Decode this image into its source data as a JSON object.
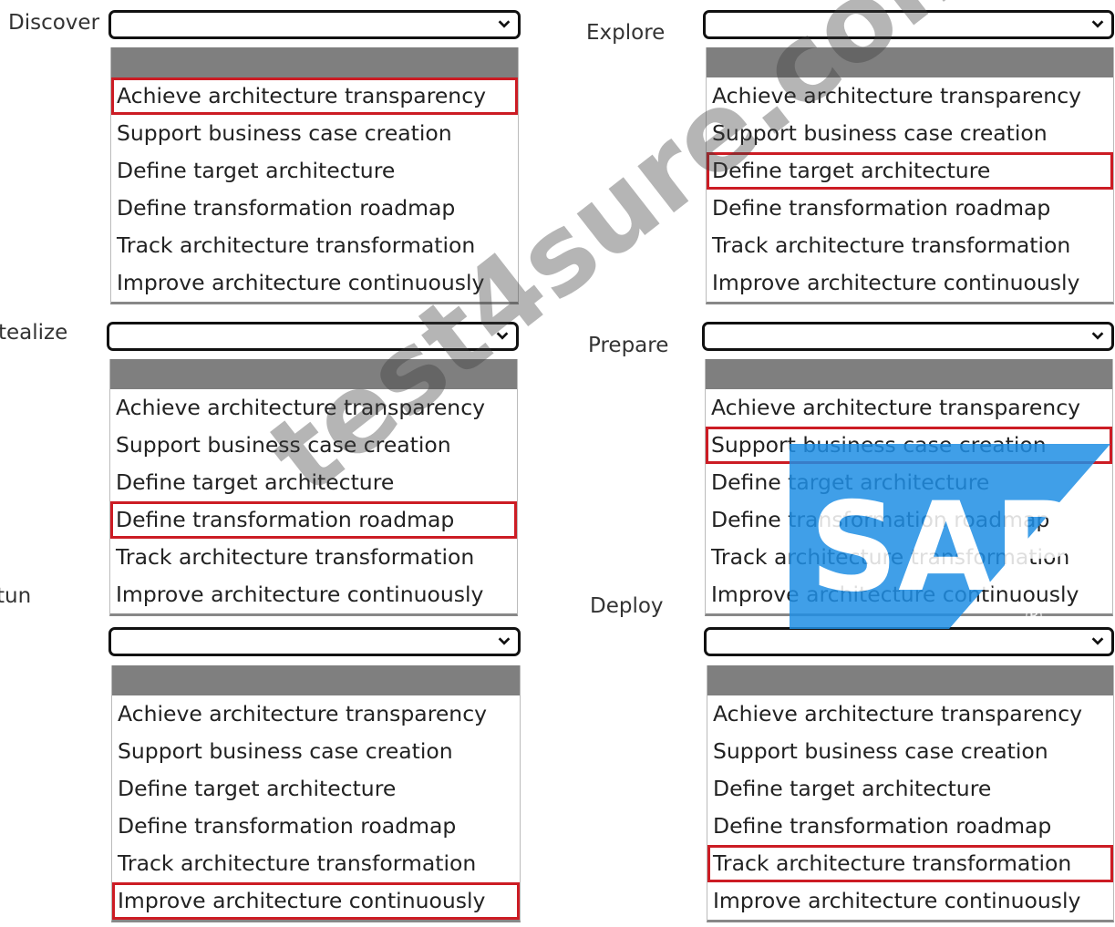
{
  "options": [
    "Achieve architecture transparency",
    "Support business case creation",
    "Define target architecture",
    "Define transformation roadmap",
    "Track architecture transformation",
    "Improve architecture continuously"
  ],
  "phases": [
    {
      "label": "Discover",
      "selected_index": 0
    },
    {
      "label": "Explore",
      "selected_index": 2
    },
    {
      "label": "tealize",
      "selected_index": 3
    },
    {
      "label": "Prepare",
      "selected_index": 1
    },
    {
      "label": "tun",
      "selected_index": 5
    },
    {
      "label": "Deploy",
      "selected_index": 4
    }
  ],
  "watermark": "test4sure.com",
  "logo": {
    "text": "SAP",
    "mark": "®",
    "color": "#1f8fe5"
  },
  "colors": {
    "highlight": "#cc1c24",
    "blank_option": "#7f7f7f"
  }
}
